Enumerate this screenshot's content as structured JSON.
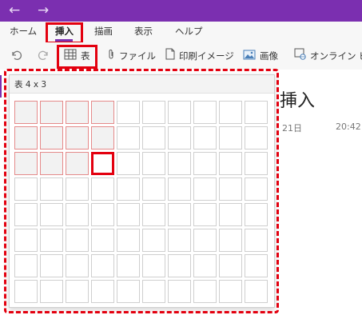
{
  "titlebar": {
    "back_icon": "arrow-left-icon",
    "forward_icon": "arrow-right-icon",
    "back_glyph": "←",
    "forward_glyph": "→",
    "color": "#7b2fb0"
  },
  "menu": {
    "items": [
      "ホーム",
      "挿入",
      "描画",
      "表示",
      "ヘルプ"
    ],
    "active": "挿入"
  },
  "toolbar": {
    "undo_icon": "undo-icon",
    "redo_icon": "redo-icon",
    "table_label": "表",
    "file_label": "ファイル",
    "printout_label": "印刷イメージ",
    "image_label": "画像",
    "online_video_label": "オンライン ビデ"
  },
  "page": {
    "title": "挿入",
    "date": "21日",
    "time": "20:42"
  },
  "table_picker": {
    "label": "表 4 x 3",
    "columns": 10,
    "rows": 8,
    "selected_columns": 4,
    "selected_rows": 3
  },
  "accent_colors": {
    "highlight": "#e3000f",
    "purple": "#7b2fb0"
  }
}
